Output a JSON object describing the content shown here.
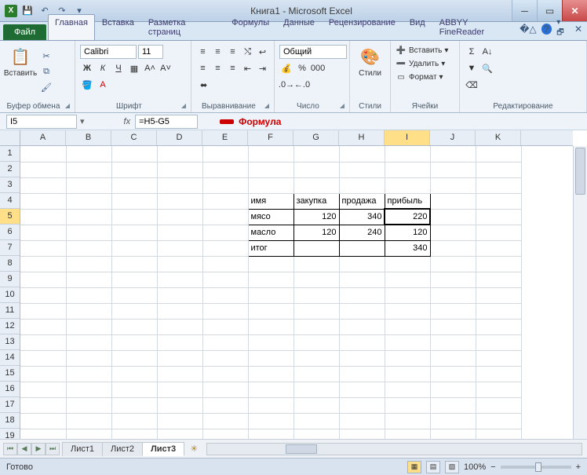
{
  "title": "Книга1 - Microsoft Excel",
  "tabs": {
    "file": "Файл",
    "items": [
      "Главная",
      "Вставка",
      "Разметка страниц",
      "Формулы",
      "Данные",
      "Рецензирование",
      "Вид",
      "ABBYY FineReader"
    ],
    "active": 0
  },
  "ribbon": {
    "clipboard": {
      "label": "Буфер обмена",
      "paste": "Вставить"
    },
    "font": {
      "label": "Шрифт",
      "name": "Calibri",
      "size": "11"
    },
    "align": {
      "label": "Выравнивание"
    },
    "number": {
      "label": "Число",
      "format": "Общий"
    },
    "styles": {
      "label": "Стили",
      "btn": "Стили"
    },
    "cells": {
      "label": "Ячейки",
      "insert": "Вставить",
      "delete": "Удалить",
      "format": "Формат"
    },
    "editing": {
      "label": "Редактирование"
    }
  },
  "namebox": "I5",
  "formula": "=H5-G5",
  "annotation": "Формула",
  "columns": [
    "A",
    "B",
    "C",
    "D",
    "E",
    "F",
    "G",
    "H",
    "I",
    "J",
    "K"
  ],
  "active_col": 8,
  "rows": 19,
  "active_row": 5,
  "table": {
    "header": [
      "имя",
      "закупка",
      "продажа",
      "прибыль"
    ],
    "rows": [
      [
        "мясо",
        "120",
        "340",
        "220"
      ],
      [
        "масло",
        "120",
        "240",
        "120"
      ],
      [
        "итог",
        "",
        "",
        "340"
      ]
    ]
  },
  "sheets": [
    "Лист1",
    "Лист2",
    "Лист3"
  ],
  "active_sheet": 2,
  "status": "Готово",
  "zoom": "100%"
}
